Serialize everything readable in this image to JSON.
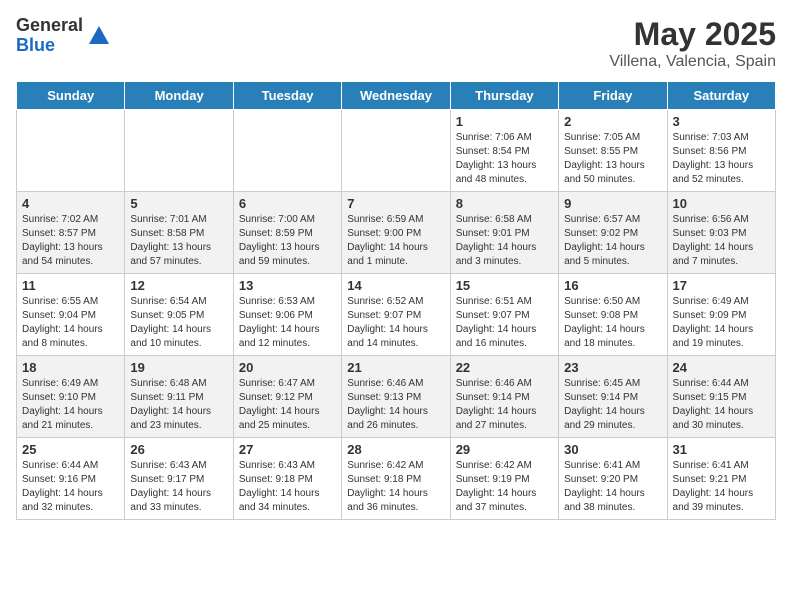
{
  "header": {
    "logo_general": "General",
    "logo_blue": "Blue",
    "title": "May 2025",
    "subtitle": "Villena, Valencia, Spain"
  },
  "weekdays": [
    "Sunday",
    "Monday",
    "Tuesday",
    "Wednesday",
    "Thursday",
    "Friday",
    "Saturday"
  ],
  "weeks": [
    [
      {
        "day": "",
        "info": ""
      },
      {
        "day": "",
        "info": ""
      },
      {
        "day": "",
        "info": ""
      },
      {
        "day": "",
        "info": ""
      },
      {
        "day": "1",
        "info": "Sunrise: 7:06 AM\nSunset: 8:54 PM\nDaylight: 13 hours\nand 48 minutes."
      },
      {
        "day": "2",
        "info": "Sunrise: 7:05 AM\nSunset: 8:55 PM\nDaylight: 13 hours\nand 50 minutes."
      },
      {
        "day": "3",
        "info": "Sunrise: 7:03 AM\nSunset: 8:56 PM\nDaylight: 13 hours\nand 52 minutes."
      }
    ],
    [
      {
        "day": "4",
        "info": "Sunrise: 7:02 AM\nSunset: 8:57 PM\nDaylight: 13 hours\nand 54 minutes."
      },
      {
        "day": "5",
        "info": "Sunrise: 7:01 AM\nSunset: 8:58 PM\nDaylight: 13 hours\nand 57 minutes."
      },
      {
        "day": "6",
        "info": "Sunrise: 7:00 AM\nSunset: 8:59 PM\nDaylight: 13 hours\nand 59 minutes."
      },
      {
        "day": "7",
        "info": "Sunrise: 6:59 AM\nSunset: 9:00 PM\nDaylight: 14 hours\nand 1 minute."
      },
      {
        "day": "8",
        "info": "Sunrise: 6:58 AM\nSunset: 9:01 PM\nDaylight: 14 hours\nand 3 minutes."
      },
      {
        "day": "9",
        "info": "Sunrise: 6:57 AM\nSunset: 9:02 PM\nDaylight: 14 hours\nand 5 minutes."
      },
      {
        "day": "10",
        "info": "Sunrise: 6:56 AM\nSunset: 9:03 PM\nDaylight: 14 hours\nand 7 minutes."
      }
    ],
    [
      {
        "day": "11",
        "info": "Sunrise: 6:55 AM\nSunset: 9:04 PM\nDaylight: 14 hours\nand 8 minutes."
      },
      {
        "day": "12",
        "info": "Sunrise: 6:54 AM\nSunset: 9:05 PM\nDaylight: 14 hours\nand 10 minutes."
      },
      {
        "day": "13",
        "info": "Sunrise: 6:53 AM\nSunset: 9:06 PM\nDaylight: 14 hours\nand 12 minutes."
      },
      {
        "day": "14",
        "info": "Sunrise: 6:52 AM\nSunset: 9:07 PM\nDaylight: 14 hours\nand 14 minutes."
      },
      {
        "day": "15",
        "info": "Sunrise: 6:51 AM\nSunset: 9:07 PM\nDaylight: 14 hours\nand 16 minutes."
      },
      {
        "day": "16",
        "info": "Sunrise: 6:50 AM\nSunset: 9:08 PM\nDaylight: 14 hours\nand 18 minutes."
      },
      {
        "day": "17",
        "info": "Sunrise: 6:49 AM\nSunset: 9:09 PM\nDaylight: 14 hours\nand 19 minutes."
      }
    ],
    [
      {
        "day": "18",
        "info": "Sunrise: 6:49 AM\nSunset: 9:10 PM\nDaylight: 14 hours\nand 21 minutes."
      },
      {
        "day": "19",
        "info": "Sunrise: 6:48 AM\nSunset: 9:11 PM\nDaylight: 14 hours\nand 23 minutes."
      },
      {
        "day": "20",
        "info": "Sunrise: 6:47 AM\nSunset: 9:12 PM\nDaylight: 14 hours\nand 25 minutes."
      },
      {
        "day": "21",
        "info": "Sunrise: 6:46 AM\nSunset: 9:13 PM\nDaylight: 14 hours\nand 26 minutes."
      },
      {
        "day": "22",
        "info": "Sunrise: 6:46 AM\nSunset: 9:14 PM\nDaylight: 14 hours\nand 27 minutes."
      },
      {
        "day": "23",
        "info": "Sunrise: 6:45 AM\nSunset: 9:14 PM\nDaylight: 14 hours\nand 29 minutes."
      },
      {
        "day": "24",
        "info": "Sunrise: 6:44 AM\nSunset: 9:15 PM\nDaylight: 14 hours\nand 30 minutes."
      }
    ],
    [
      {
        "day": "25",
        "info": "Sunrise: 6:44 AM\nSunset: 9:16 PM\nDaylight: 14 hours\nand 32 minutes."
      },
      {
        "day": "26",
        "info": "Sunrise: 6:43 AM\nSunset: 9:17 PM\nDaylight: 14 hours\nand 33 minutes."
      },
      {
        "day": "27",
        "info": "Sunrise: 6:43 AM\nSunset: 9:18 PM\nDaylight: 14 hours\nand 34 minutes."
      },
      {
        "day": "28",
        "info": "Sunrise: 6:42 AM\nSunset: 9:18 PM\nDaylight: 14 hours\nand 36 minutes."
      },
      {
        "day": "29",
        "info": "Sunrise: 6:42 AM\nSunset: 9:19 PM\nDaylight: 14 hours\nand 37 minutes."
      },
      {
        "day": "30",
        "info": "Sunrise: 6:41 AM\nSunset: 9:20 PM\nDaylight: 14 hours\nand 38 minutes."
      },
      {
        "day": "31",
        "info": "Sunrise: 6:41 AM\nSunset: 9:21 PM\nDaylight: 14 hours\nand 39 minutes."
      }
    ]
  ]
}
